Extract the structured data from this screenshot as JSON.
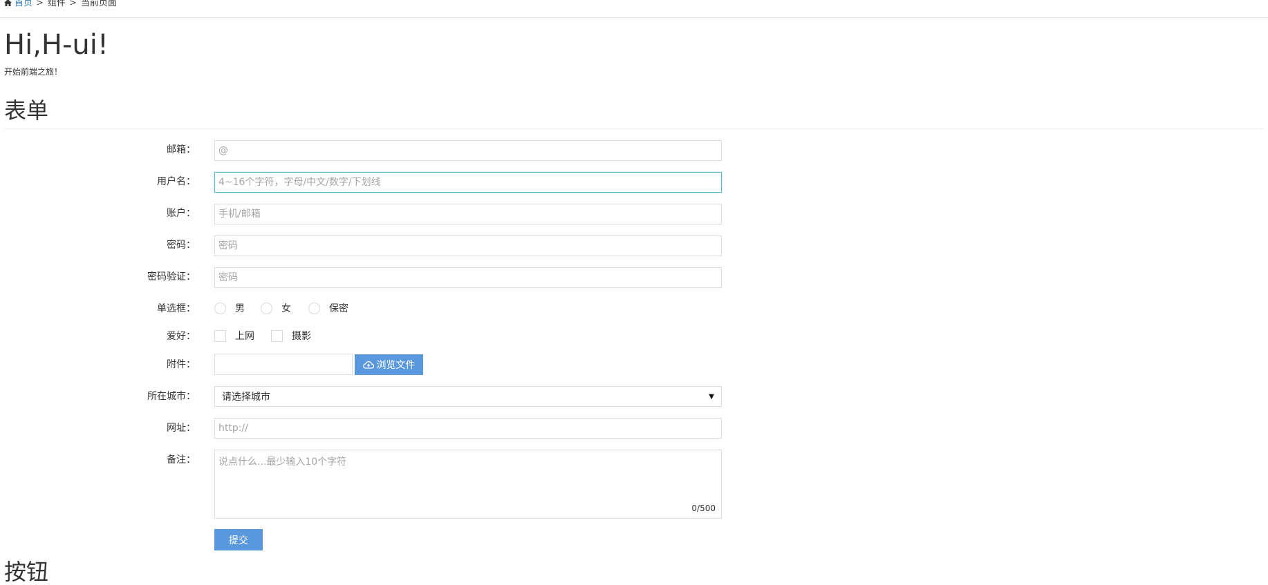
{
  "breadcrumb": {
    "home": "首页",
    "sep1": ">",
    "component": "组件",
    "sep2": ">",
    "current": "当前页面"
  },
  "hero": {
    "title": "Hi,H-ui!",
    "subtitle": "开始前端之旅！"
  },
  "sections": {
    "form_title": "表单",
    "buttons_title": "按钮"
  },
  "form": {
    "email": {
      "label": "邮箱：",
      "placeholder": "@"
    },
    "username": {
      "label": "用户名：",
      "placeholder": "4~16个字符，字母/中文/数字/下划线"
    },
    "account": {
      "label": "账户：",
      "placeholder": "手机/邮箱"
    },
    "password": {
      "label": "密码：",
      "placeholder": "密码"
    },
    "password_confirm": {
      "label": "密码验证：",
      "placeholder": "密码"
    },
    "radio": {
      "label": "单选框：",
      "options": [
        "男",
        "女",
        "保密"
      ]
    },
    "hobby": {
      "label": "爱好：",
      "options": [
        "上网",
        "摄影"
      ]
    },
    "attachment": {
      "label": "附件：",
      "browse_label": "浏览文件"
    },
    "city": {
      "label": "所在城市：",
      "selected": "请选择城市"
    },
    "url": {
      "label": "网址：",
      "placeholder": "http://"
    },
    "note": {
      "label": "备注：",
      "placeholder": "说点什么...最少输入10个字符",
      "counter": "0/500"
    },
    "submit_label": "提交"
  },
  "colors": {
    "primary": "#5a98de",
    "link": "#337ab7",
    "focus_border": "#5eb6d6"
  }
}
